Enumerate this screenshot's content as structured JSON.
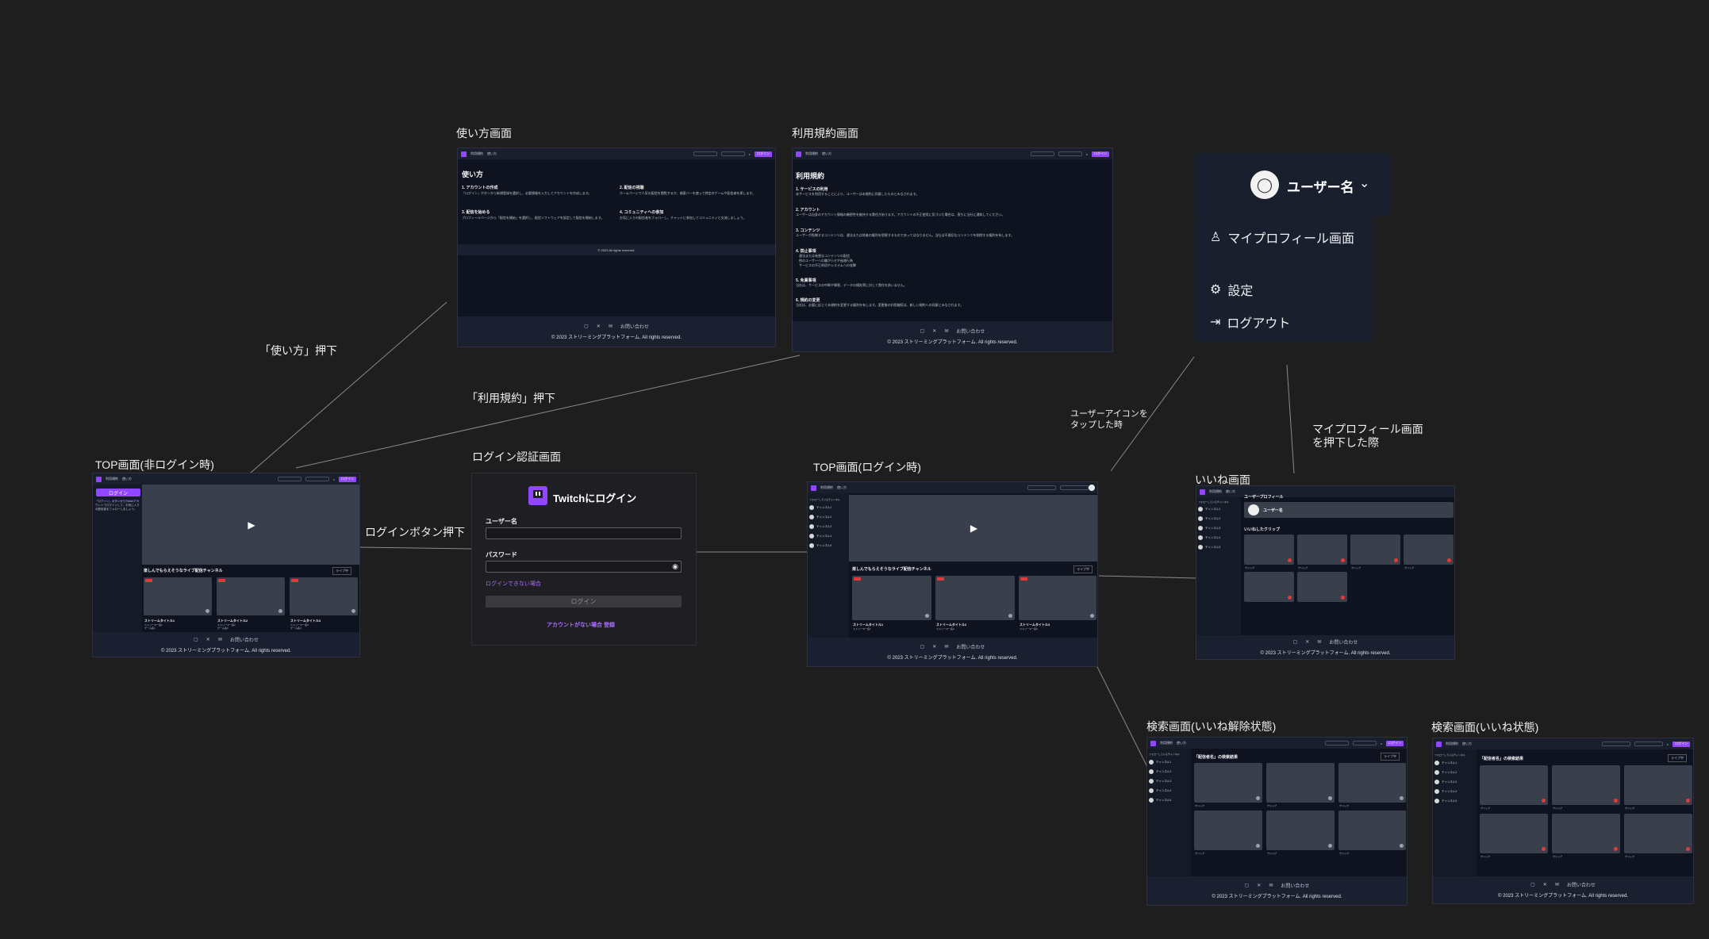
{
  "labels": {
    "usage_title": "使い方画面",
    "terms_title": "利用規約画面",
    "top_guest_title": "TOP画面(非ログイン時)",
    "login_title": "ログイン認証画面",
    "top_login_title": "TOP画面(ログイン時)",
    "likes_title": "いいね画面",
    "search_off_title": "検索画面(いいね解除状態)",
    "search_on_title": "検索画面(いいね状態)"
  },
  "notes": {
    "usage_press": "「使い方」押下",
    "terms_press": "「利用規約」押下",
    "login_press": "ログインボタン押下",
    "user_icon_tap": "ユーザーアイコンを\nタップした時",
    "myprofile_press": "マイプロフィール画面\nを押下した際"
  },
  "common": {
    "nav_links": [
      "利用規約",
      "使い方"
    ],
    "login_btn": "ログイン",
    "contact": "お問い合わせ",
    "copyright": "© 2023 ストリーミングプラットフォーム. All rights reserved.",
    "copyright_short": "© 2023 All rights reserved.",
    "section_title": "楽しんでもらえそうなライブ配信チャンネル",
    "sort_label": "ライブ中",
    "stream_titles": [
      "ストリームタイトル1",
      "ストリームタイトル2",
      "ストリームタイトル3"
    ],
    "streamer_names": [
      "ストリーマー名1",
      "ストリーマー名2",
      "ストリーマー名3"
    ],
    "game_names": [
      "ゲーム名1",
      "ゲーム名2",
      "ゲーム名3"
    ],
    "live_badge": "LIVE",
    "side_heading": "フォローしているチャンネル",
    "side_channels": [
      "チャンネル1",
      "チャンネル2",
      "チャンネル3",
      "チャンネル4",
      "チャンネル5"
    ],
    "guest_login_cta": "ログイン",
    "guest_login_note": "「ログイン」ボタンからTwitchアカウントでログインして、お気に入りの配信者をフォローしましょう。"
  },
  "usage_page": {
    "heading": "使い方",
    "sections": [
      {
        "title": "1. アカウントの作成",
        "body": "「ログイン」ボタンから新規登録を選択し、必要情報を入力してアカウントを作成します。"
      },
      {
        "title": "2. 配信の視聴",
        "body": "ホームページで人気の配信を閲覧するか、検索バーを使って特定のゲームや配信者を探します。"
      },
      {
        "title": "3. 配信を始める",
        "body": "プロフィールページから「配信を開始」を選択し、配信ソフトウェアを設定して配信を開始します。"
      },
      {
        "title": "4. コミュニティへの参加",
        "body": "お気に入りの配信者をフォローし、チャットに参加してコミュニティと交流しましょう。"
      }
    ]
  },
  "terms_page": {
    "heading": "利用規約",
    "sections": [
      {
        "title": "1. サービスの利用",
        "body": "本サービスを利用することにより、ユーザーは本規約に同意したものとみなされます。"
      },
      {
        "title": "2. アカウント",
        "body": "ユーザーは自身のアカウント情報の機密性を維持する責任があります。アカウントの不正使用に気づいた場合は、直ちに当社に通知してください。"
      },
      {
        "title": "3. コンテンツ",
        "body": "ユーザーが投稿するコンテンツは、違法または他者の権利を侵害するものであってはなりません。当社は不適切なコンテンツを削除する権利を有します。"
      },
      {
        "title": "4. 禁止事項",
        "items": [
          "違法または有害なコンテンツの配信",
          "他のユーザーへの嫌がらせや迷惑行為",
          "サービスの不正利用やシステムへの攻撃"
        ]
      },
      {
        "title": "5. 免責事項",
        "body": "当社は、サービスの中断や障害、データの損失等に対して責任を負いません。"
      },
      {
        "title": "6. 規約の変更",
        "body": "当社は、必要に応じて本規約を変更する権利を有します。変更後の利用継続は、新しい規約への同意とみなされます。"
      }
    ]
  },
  "login_page": {
    "title": "Twitchにログイン",
    "username_label": "ユーザー名",
    "password_label": "パスワード",
    "forgot": "ログインできない場合",
    "submit": "ログイン",
    "signup": "アカウントがない場合 登録"
  },
  "dropdown": {
    "username": "ユーザー名",
    "items": [
      "マイプロフィール画面",
      "設定",
      "ログアウト"
    ]
  },
  "likes_page": {
    "heading": "ユーザープロフィール",
    "username": "ユーザー名",
    "clips_title": "いいねしたクリップ",
    "clip_label": "クリップ"
  },
  "search_page": {
    "heading": "「配信者名」の検索結果",
    "sort_label": "ライブ中"
  }
}
